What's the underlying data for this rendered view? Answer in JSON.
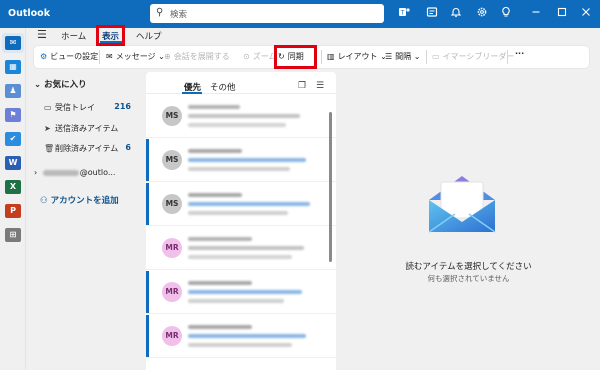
{
  "app": {
    "title": "Outlook"
  },
  "search": {
    "placeholder": "検索"
  },
  "titlebar_icons": [
    "teams-icon",
    "calendar-notes-icon",
    "bell-icon",
    "gear-icon",
    "lightbulb-icon",
    "minimize-icon",
    "maximize-icon",
    "close-icon"
  ],
  "tabs": [
    {
      "label": "ホーム"
    },
    {
      "label": "表示",
      "active": true
    },
    {
      "label": "ヘルプ"
    }
  ],
  "toolbar": {
    "view_settings": "ビューの設定",
    "messages": "メッセージ",
    "expand_all": "会話を展開する",
    "zoom": "ズーム",
    "sync": "同期",
    "layout": "レイアウト",
    "density": "間隔",
    "immersive_reader": "イマーシブリーダー",
    "more": "···"
  },
  "folders": {
    "favorites_label": "お気に入り",
    "items": [
      {
        "label": "受信トレイ",
        "count": "216"
      },
      {
        "label": "送信済みアイテム",
        "count": ""
      },
      {
        "label": "削除済みアイテム",
        "count": "6"
      }
    ],
    "account": "@outlo...",
    "add_account": "アカウントを追加"
  },
  "message_list": {
    "tab_focused": "優先",
    "tab_other": "その他",
    "avatars": [
      "MS",
      "MS",
      "MS",
      "MR",
      "MR",
      "MR"
    ]
  },
  "reading_pane": {
    "main_text": "読むアイテムを選択してください",
    "sub_text": "何も選択されていません"
  },
  "colors": {
    "accent": "#0f6cbd",
    "highlight_box": "#e00012"
  }
}
